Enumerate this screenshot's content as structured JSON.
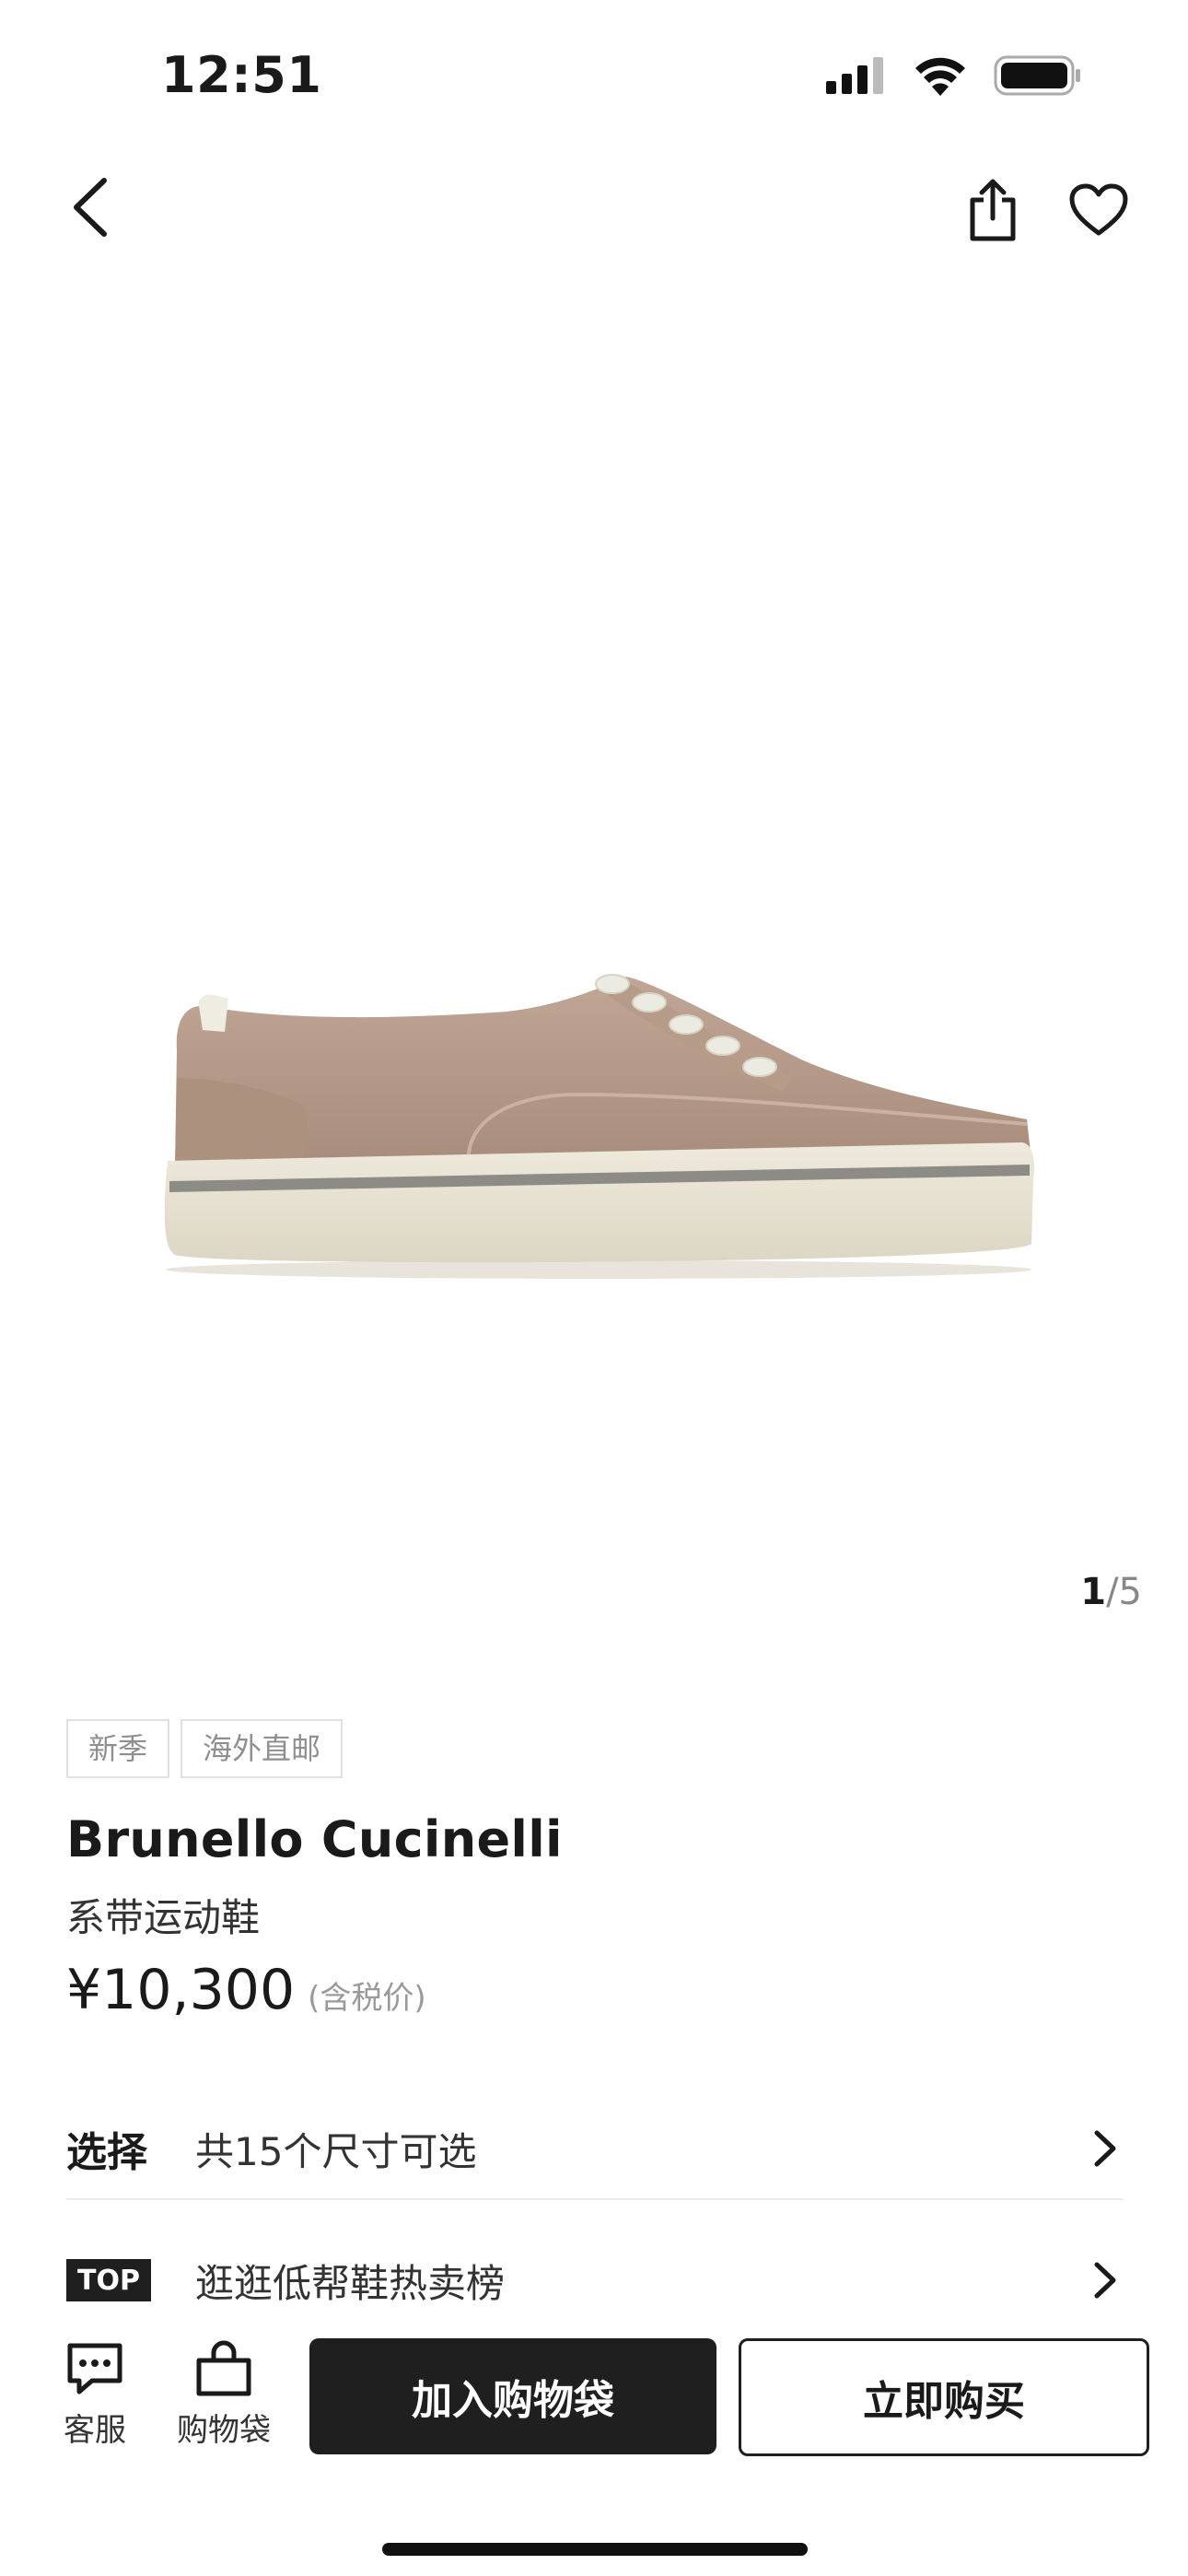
{
  "status_bar": {
    "time": "12:51"
  },
  "gallery": {
    "current": "1",
    "total": "5"
  },
  "product": {
    "tags": [
      "新季",
      "海外直邮"
    ],
    "brand": "Brunello Cucinelli",
    "name": "系带运动鞋",
    "price": "¥10,300",
    "tax_note": "(含税价)"
  },
  "rows": {
    "select_label": "选择",
    "select_text": "共15个尺寸可选",
    "top_badge": "TOP",
    "top_text": "逛逛低帮鞋热卖榜"
  },
  "bottom_bar": {
    "service_label": "客服",
    "bag_label": "购物袋",
    "add_to_bag": "加入购物袋",
    "buy_now": "立即购买"
  },
  "icons": {
    "back": "chevron-left-icon",
    "share": "share-icon",
    "favorite": "heart-icon",
    "service": "chat-icon",
    "bag": "shopping-bag-icon"
  }
}
